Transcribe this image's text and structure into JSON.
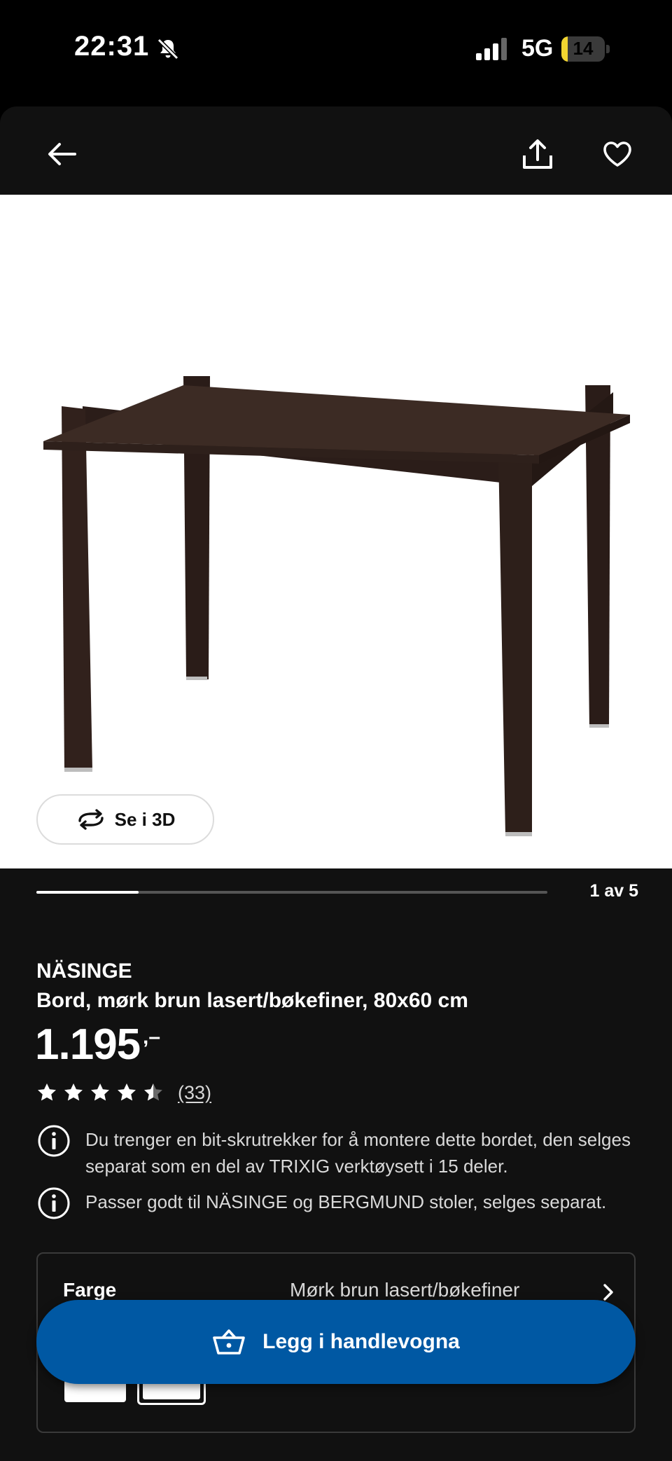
{
  "status_bar": {
    "time": "22:31",
    "network": "5G",
    "battery": "14",
    "battery_level": 0.14,
    "battery_color": "#f2d530"
  },
  "toolbar": {
    "back_icon": "arrow-left-icon",
    "share_icon": "share-icon",
    "favorite_icon": "heart-icon"
  },
  "gallery": {
    "view_3d_label": "Se i 3D",
    "view_3d_icon": "rotate-icon",
    "current": 1,
    "total": 5,
    "counter_text": "1 av 5"
  },
  "product": {
    "brand": "NÄSINGE",
    "description": "Bord, mørk brun lasert/bøkefiner, 80x60 cm",
    "price": "1.195",
    "price_suffix": ",–",
    "rating": 4.5,
    "review_count": "(33)",
    "notices": [
      {
        "icon": "info-icon",
        "text": "Du trenger en bit-skrutrekker for å montere dette bordet, den selges separat som en del av TRIXIG verktøysett i 15 deler."
      },
      {
        "icon": "info-icon",
        "text": "Passer godt til NÄSINGE og BERGMUND  stoler, selges separat."
      }
    ]
  },
  "variant": {
    "label": "Farge",
    "value": "Mørk brun lasert/bøkefiner"
  },
  "cart": {
    "label": "Legg i handlevogna",
    "icon": "basket-icon",
    "color": "#0058a3"
  }
}
